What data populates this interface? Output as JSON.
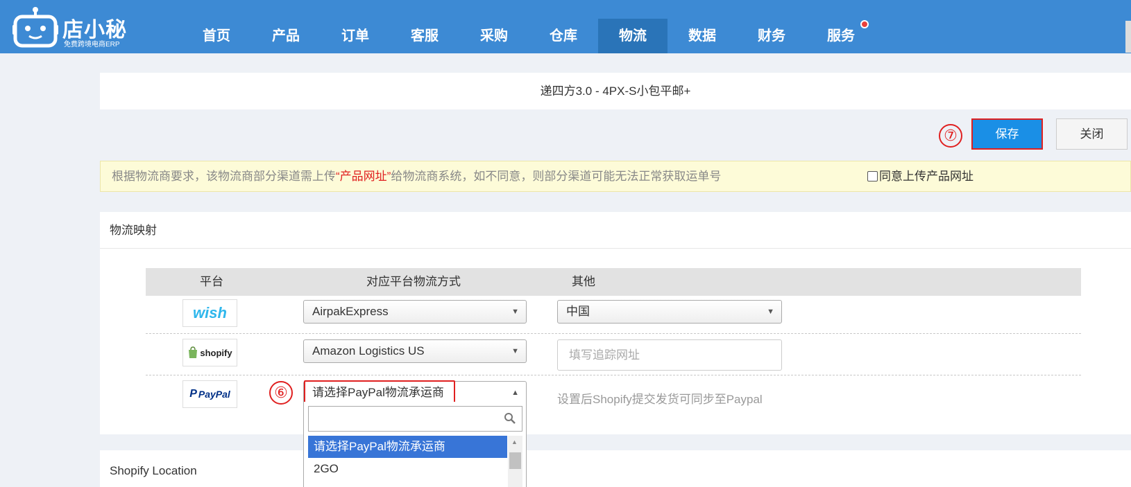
{
  "brand": {
    "name": "店小秘",
    "tagline": "免费跨境电商ERP"
  },
  "nav": {
    "items": [
      "首页",
      "产品",
      "订单",
      "客服",
      "采购",
      "仓库",
      "物流",
      "数据",
      "财务",
      "服务"
    ],
    "active": "物流"
  },
  "title": "递四方3.0   -   4PX-S小包平邮+",
  "annotations": {
    "save_marker": "⑦",
    "dropdown_marker": "⑥"
  },
  "actions": {
    "save": "保存",
    "close": "关闭"
  },
  "notice": {
    "before": "根据物流商要求，该物流商部分渠道需上传",
    "highlight": "“产品网址”",
    "after": "给物流商系统，如不同意，则部分渠道可能无法正常获取运单号",
    "checkbox_label": "同意上传产品网址"
  },
  "mapping": {
    "heading": "物流映射",
    "columns": [
      "平台",
      "对应平台物流方式",
      "其他"
    ],
    "rows": [
      {
        "platform": "wish",
        "method": "AirpakExpress",
        "other": "中国"
      },
      {
        "platform": "shopify",
        "method": "Amazon Logistics US",
        "other_placeholder": "填写追踪网址"
      },
      {
        "platform": "PayPal",
        "method": "请选择PayPal物流承运商",
        "other_hint": "设置后Shopify提交发货可同步至Paypal"
      }
    ]
  },
  "dropdown": {
    "search_value": "",
    "options": [
      "请选择PayPal物流承运商",
      "2GO"
    ],
    "highlighted": "请选择PayPal物流承运商"
  },
  "location_section": {
    "heading": "Shopify Location"
  },
  "colors": {
    "nav_bg": "#3d8ad4",
    "nav_active": "#2a74b8",
    "primary_button": "#1a8fe6",
    "annotation_red": "#e02020"
  }
}
